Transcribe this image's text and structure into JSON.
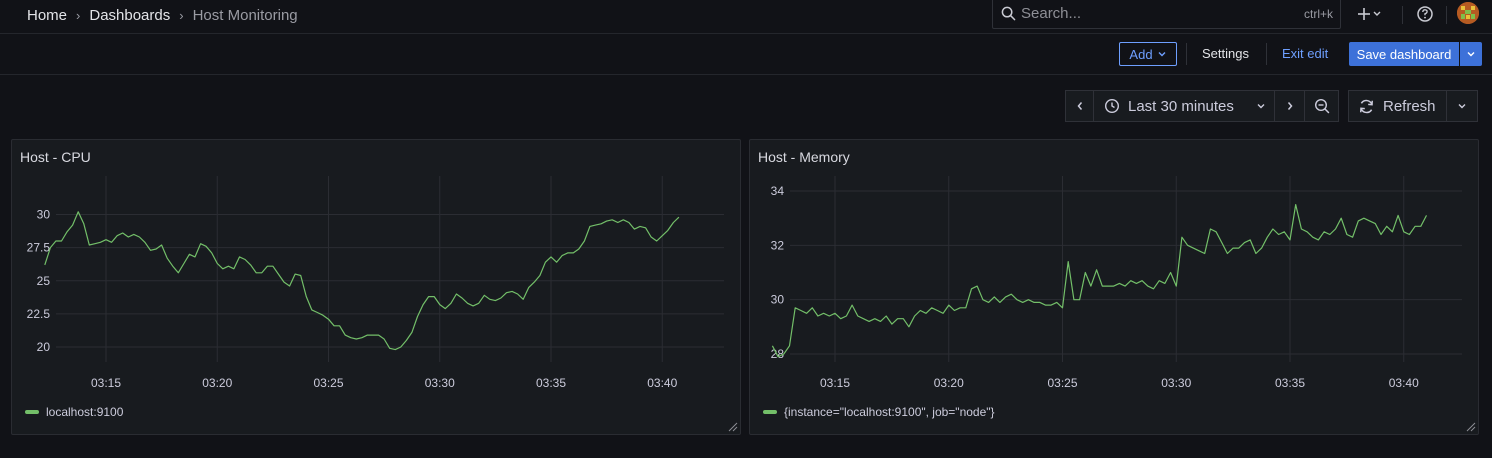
{
  "breadcrumb": {
    "items": [
      "Home",
      "Dashboards",
      "Host Monitoring"
    ]
  },
  "search": {
    "placeholder": "Search...",
    "shortcut": "ctrl+k"
  },
  "toolbar": {
    "add_label": "Add",
    "settings_label": "Settings",
    "exit_edit_label": "Exit edit",
    "save_label": "Save dashboard"
  },
  "time_picker": {
    "range_label": "Last 30 minutes",
    "refresh_label": "Refresh"
  },
  "colors": {
    "series": "#73bf69",
    "accent": "#3d71d9",
    "link": "#6e9fff"
  },
  "panels": [
    {
      "title": "Host - CPU",
      "legend": "localhost:9100",
      "chart_data": {
        "type": "line",
        "x_ticks": [
          "03:15",
          "03:20",
          "03:25",
          "03:30",
          "03:35",
          "03:40"
        ],
        "y_ticks": [
          "20",
          "22.5",
          "25",
          "27.5",
          "30"
        ],
        "ylim": [
          19.5,
          31
        ],
        "series": [
          {
            "name": "localhost:9100",
            "x": [
              "03:12:15",
              "03:12:30",
              "03:12:45",
              "03:13:00",
              "03:13:15",
              "03:13:30",
              "03:13:45",
              "03:14:00",
              "03:14:15",
              "03:14:30",
              "03:14:45",
              "03:15:00",
              "03:15:15",
              "03:15:30",
              "03:15:45",
              "03:16:00",
              "03:16:15",
              "03:16:30",
              "03:16:45",
              "03:17:00",
              "03:17:15",
              "03:17:30",
              "03:17:45",
              "03:18:00",
              "03:18:15",
              "03:18:30",
              "03:18:45",
              "03:19:00",
              "03:19:15",
              "03:19:30",
              "03:19:45",
              "03:20:00",
              "03:20:15",
              "03:20:30",
              "03:20:45",
              "03:21:00",
              "03:21:15",
              "03:21:30",
              "03:21:45",
              "03:22:00",
              "03:22:15",
              "03:22:30",
              "03:22:45",
              "03:23:00",
              "03:23:15",
              "03:23:30",
              "03:23:45",
              "03:24:00",
              "03:24:15",
              "03:24:30",
              "03:24:45",
              "03:25:00",
              "03:25:15",
              "03:25:30",
              "03:25:45",
              "03:26:00",
              "03:26:15",
              "03:26:30",
              "03:26:45",
              "03:27:00",
              "03:27:15",
              "03:27:30",
              "03:27:45",
              "03:28:00",
              "03:28:15",
              "03:28:30",
              "03:28:45",
              "03:29:00",
              "03:29:15",
              "03:29:30",
              "03:29:45",
              "03:30:00",
              "03:30:15",
              "03:30:30",
              "03:30:45",
              "03:31:00",
              "03:31:15",
              "03:31:30",
              "03:31:45",
              "03:32:00",
              "03:32:15",
              "03:32:30",
              "03:32:45",
              "03:33:00",
              "03:33:15",
              "03:33:30",
              "03:33:45",
              "03:34:00",
              "03:34:15",
              "03:34:30",
              "03:34:45",
              "03:35:00",
              "03:35:15",
              "03:35:30",
              "03:35:45",
              "03:36:00",
              "03:36:15",
              "03:36:30",
              "03:36:45",
              "03:37:00",
              "03:37:15",
              "03:37:30",
              "03:37:45",
              "03:38:00",
              "03:38:15",
              "03:38:30",
              "03:38:45",
              "03:39:00",
              "03:39:15",
              "03:39:30",
              "03:39:45",
              "03:40:00",
              "03:40:15",
              "03:40:30",
              "03:40:45",
              "03:41:00",
              "03:41:15",
              "03:41:30",
              "03:41:45",
              "03:42:00",
              "03:42:15",
              "03:42:30"
            ],
            "y": [
              26.2,
              27.5,
              28.0,
              28.0,
              28.7,
              29.2,
              30.2,
              29.3,
              27.7,
              27.8,
              27.9,
              28.1,
              27.9,
              28.4,
              28.6,
              28.3,
              28.5,
              28.3,
              27.9,
              27.3,
              27.4,
              27.7,
              26.7,
              26.1,
              25.6,
              26.3,
              27.0,
              26.8,
              27.8,
              27.6,
              27.1,
              26.3,
              25.9,
              26.1,
              25.9,
              26.8,
              26.6,
              26.2,
              25.6,
              25.6,
              26.1,
              26.1,
              25.5,
              24.9,
              24.6,
              25.5,
              25.4,
              23.8,
              22.8,
              22.6,
              22.4,
              22.1,
              21.6,
              21.6,
              20.9,
              20.7,
              20.6,
              20.7,
              20.9,
              20.9,
              20.9,
              20.6,
              19.9,
              19.8,
              20.0,
              20.5,
              21.1,
              22.3,
              23.2,
              23.8,
              23.8,
              23.2,
              22.9,
              23.3,
              24.0,
              23.7,
              23.3,
              23.1,
              23.3,
              23.9,
              23.6,
              23.5,
              23.7,
              24.1,
              24.2,
              24.0,
              23.6,
              24.5,
              24.9,
              25.4,
              26.4,
              26.8,
              26.4,
              26.9,
              27.1,
              27.1,
              27.4,
              28.0,
              29.1,
              29.2,
              29.3,
              29.5,
              29.6,
              29.4,
              29.6,
              29.4,
              28.9,
              29.1,
              29.0,
              28.3,
              28.0,
              28.4,
              28.8,
              29.4,
              29.8
            ]
          }
        ]
      }
    },
    {
      "title": "Host - Memory",
      "legend": "{instance=\"localhost:9100\", job=\"node\"}",
      "chart_data": {
        "type": "line",
        "x_ticks": [
          "03:15",
          "03:20",
          "03:25",
          "03:30",
          "03:35",
          "03:40"
        ],
        "y_ticks": [
          "28",
          "30",
          "32",
          "34"
        ],
        "ylim": [
          27.5,
          34.5
        ],
        "series": [
          {
            "name": "{instance=\"localhost:9100\", job=\"node\"}",
            "x": [
              "03:12:15",
              "03:12:30",
              "03:12:45",
              "03:13:00",
              "03:13:15",
              "03:13:30",
              "03:13:45",
              "03:14:00",
              "03:14:15",
              "03:14:30",
              "03:14:45",
              "03:15:00",
              "03:15:15",
              "03:15:30",
              "03:15:45",
              "03:16:00",
              "03:16:15",
              "03:16:30",
              "03:16:45",
              "03:17:00",
              "03:17:15",
              "03:17:30",
              "03:17:45",
              "03:18:00",
              "03:18:15",
              "03:18:30",
              "03:18:45",
              "03:19:00",
              "03:19:15",
              "03:19:30",
              "03:19:45",
              "03:20:00",
              "03:20:15",
              "03:20:30",
              "03:20:45",
              "03:21:00",
              "03:21:15",
              "03:21:30",
              "03:21:45",
              "03:22:00",
              "03:22:15",
              "03:22:30",
              "03:22:45",
              "03:23:00",
              "03:23:15",
              "03:23:30",
              "03:23:45",
              "03:24:00",
              "03:24:15",
              "03:24:30",
              "03:24:45",
              "03:25:00",
              "03:25:15",
              "03:25:30",
              "03:25:45",
              "03:26:00",
              "03:26:15",
              "03:26:30",
              "03:26:45",
              "03:27:00",
              "03:27:15",
              "03:27:30",
              "03:27:45",
              "03:28:00",
              "03:28:15",
              "03:28:30",
              "03:28:45",
              "03:29:00",
              "03:29:15",
              "03:29:30",
              "03:29:45",
              "03:30:00",
              "03:30:15",
              "03:30:30",
              "03:30:45",
              "03:31:00",
              "03:31:15",
              "03:31:30",
              "03:31:45",
              "03:32:00",
              "03:32:15",
              "03:32:30",
              "03:32:45",
              "03:33:00",
              "03:33:15",
              "03:33:30",
              "03:33:45",
              "03:34:00",
              "03:34:15",
              "03:34:30",
              "03:34:45",
              "03:35:00",
              "03:35:15",
              "03:35:30",
              "03:35:45",
              "03:36:00",
              "03:36:15",
              "03:36:30",
              "03:36:45",
              "03:37:00",
              "03:37:15",
              "03:37:30",
              "03:37:45",
              "03:38:00",
              "03:38:15",
              "03:38:30",
              "03:38:45",
              "03:39:00",
              "03:39:15",
              "03:39:30",
              "03:39:45",
              "03:40:00",
              "03:40:15",
              "03:40:30",
              "03:40:45",
              "03:41:00",
              "03:41:15",
              "03:41:30",
              "03:41:45",
              "03:42:00",
              "03:42:15",
              "03:42:30"
            ],
            "y": [
              28.3,
              27.9,
              28.0,
              28.3,
              29.7,
              29.6,
              29.5,
              29.7,
              29.4,
              29.5,
              29.4,
              29.5,
              29.3,
              29.4,
              29.8,
              29.4,
              29.3,
              29.2,
              29.3,
              29.2,
              29.4,
              29.1,
              29.3,
              29.3,
              29.0,
              29.4,
              29.6,
              29.5,
              29.7,
              29.6,
              29.5,
              29.8,
              29.6,
              29.7,
              29.7,
              30.4,
              30.5,
              30.0,
              29.9,
              30.1,
              29.9,
              30.1,
              30.2,
              30.0,
              29.9,
              30.0,
              29.9,
              29.9,
              29.8,
              29.8,
              29.9,
              29.7,
              31.4,
              30.0,
              30.0,
              31.0,
              30.5,
              31.1,
              30.5,
              30.5,
              30.5,
              30.6,
              30.5,
              30.7,
              30.6,
              30.7,
              30.5,
              30.4,
              30.7,
              30.6,
              31.0,
              30.5,
              32.3,
              32.0,
              31.9,
              31.8,
              31.7,
              32.6,
              32.5,
              32.1,
              31.7,
              31.9,
              31.9,
              32.1,
              32.2,
              31.7,
              31.9,
              32.3,
              32.6,
              32.4,
              32.5,
              32.2,
              33.5,
              32.6,
              32.5,
              32.3,
              32.2,
              32.5,
              32.4,
              32.6,
              33.0,
              32.4,
              32.3,
              32.9,
              33.0,
              32.9,
              32.8,
              32.4,
              32.7,
              32.5,
              33.1,
              32.5,
              32.4,
              32.7,
              32.7,
              33.1
            ]
          }
        ]
      }
    }
  ]
}
